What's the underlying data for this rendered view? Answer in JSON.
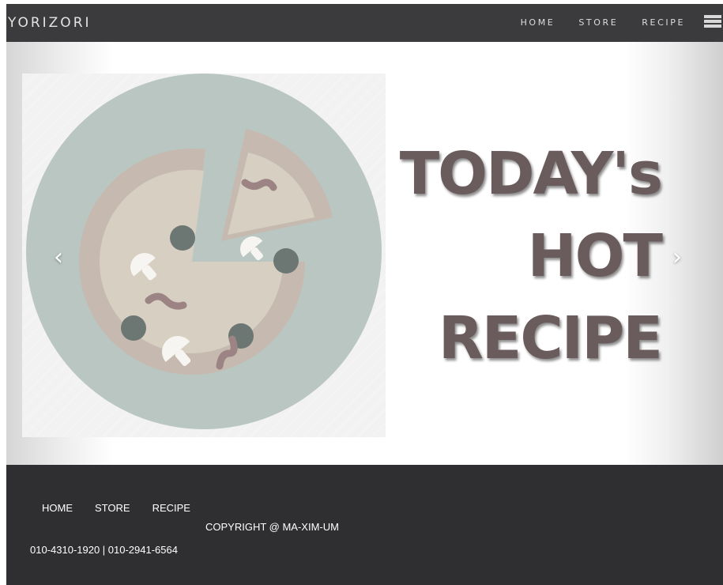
{
  "header": {
    "brand": "YORIZORI",
    "nav": [
      "HOME",
      "STORE",
      "RECIPE"
    ]
  },
  "hero": {
    "headline_line1": "TODAY's",
    "headline_line2": "HOT",
    "headline_line3": "RECIPE",
    "prev_glyph": "‹",
    "next_glyph": "›",
    "image_icon": "pizza-illustration"
  },
  "footer": {
    "nav": [
      "HOME",
      "STORE",
      "RECIPE"
    ],
    "copyright": "COPYRIGHT @ MA-XIM-UM",
    "phones": "010-4310-1920 | 010-2941-6564"
  },
  "colors": {
    "navbar": "#3b3b3d",
    "footer": "#2f2f31",
    "plate": "#b8c6c2",
    "crust": "#c6bab0",
    "cheese": "#d6cfc2",
    "headline": "#6a5c5c"
  }
}
